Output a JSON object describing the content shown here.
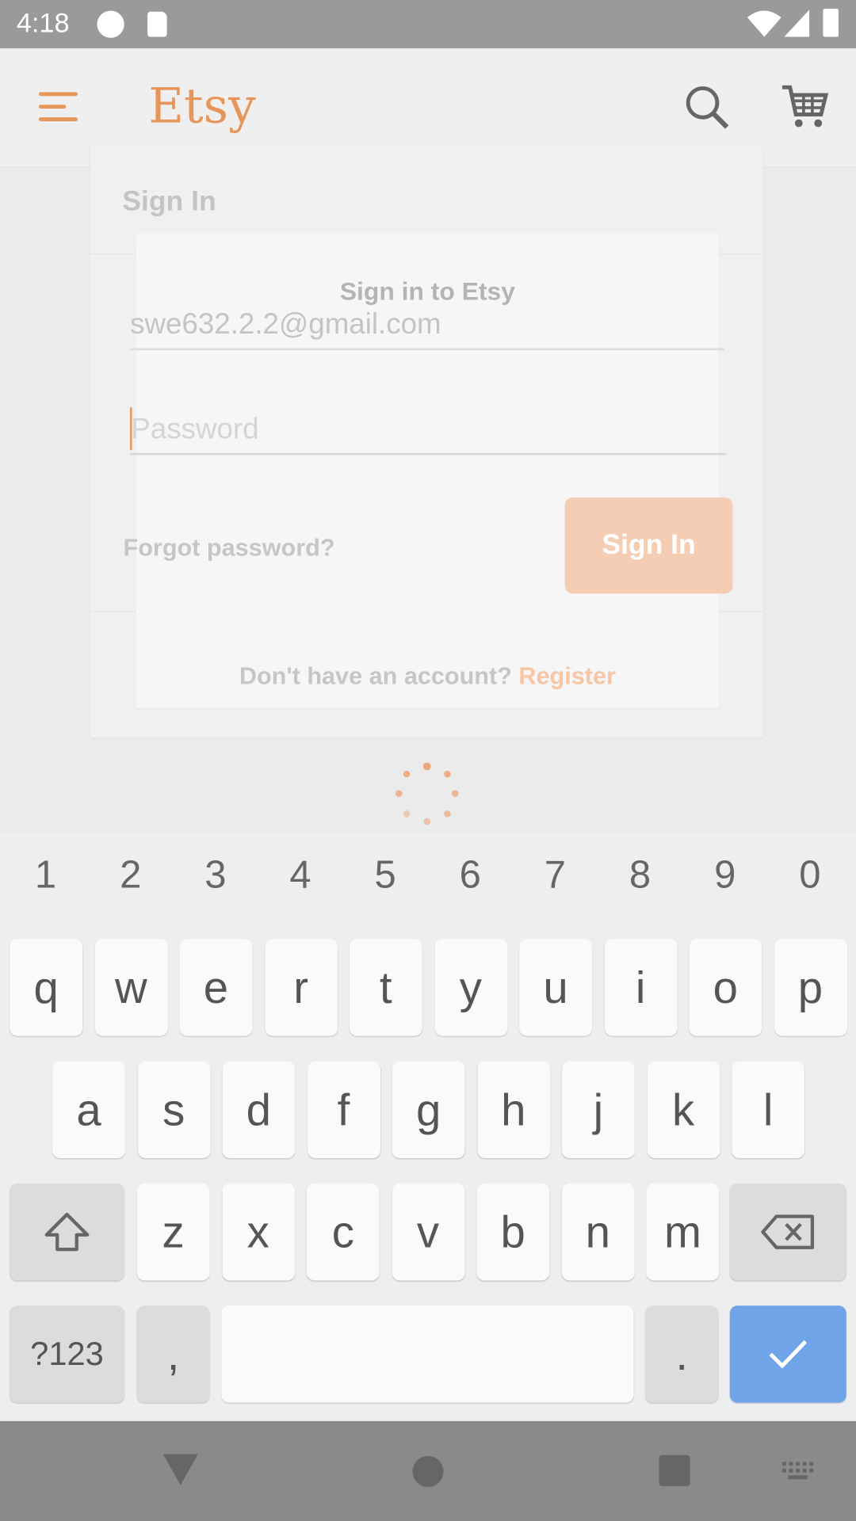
{
  "status_bar": {
    "time": "4:18"
  },
  "app_bar": {
    "logo": "Etsy",
    "menu_icon": "hamburger-menu-icon",
    "search_icon": "search-icon",
    "cart_icon": "cart-icon"
  },
  "page": {
    "title": "Sign In"
  },
  "dialog": {
    "title": "Sign in to Etsy",
    "email_value": "swe632.2.2@gmail.com",
    "password_placeholder": "Password",
    "forgot_password": "Forgot password?",
    "sign_in_button": "Sign In",
    "no_account_text": "Don't have an account?",
    "register_link": "Register"
  },
  "colors": {
    "brand": "#e8955a",
    "button_faded": "#f5cdb5",
    "enter_key": "#6fa4e8"
  },
  "keyboard": {
    "numbers": [
      "1",
      "2",
      "3",
      "4",
      "5",
      "6",
      "7",
      "8",
      "9",
      "0"
    ],
    "row1": [
      "q",
      "w",
      "e",
      "r",
      "t",
      "y",
      "u",
      "i",
      "o",
      "p"
    ],
    "row2": [
      "a",
      "s",
      "d",
      "f",
      "g",
      "h",
      "j",
      "k",
      "l"
    ],
    "row3": [
      "z",
      "x",
      "c",
      "v",
      "b",
      "n",
      "m"
    ],
    "symbols_key": "?123",
    "comma": ",",
    "period": "."
  }
}
